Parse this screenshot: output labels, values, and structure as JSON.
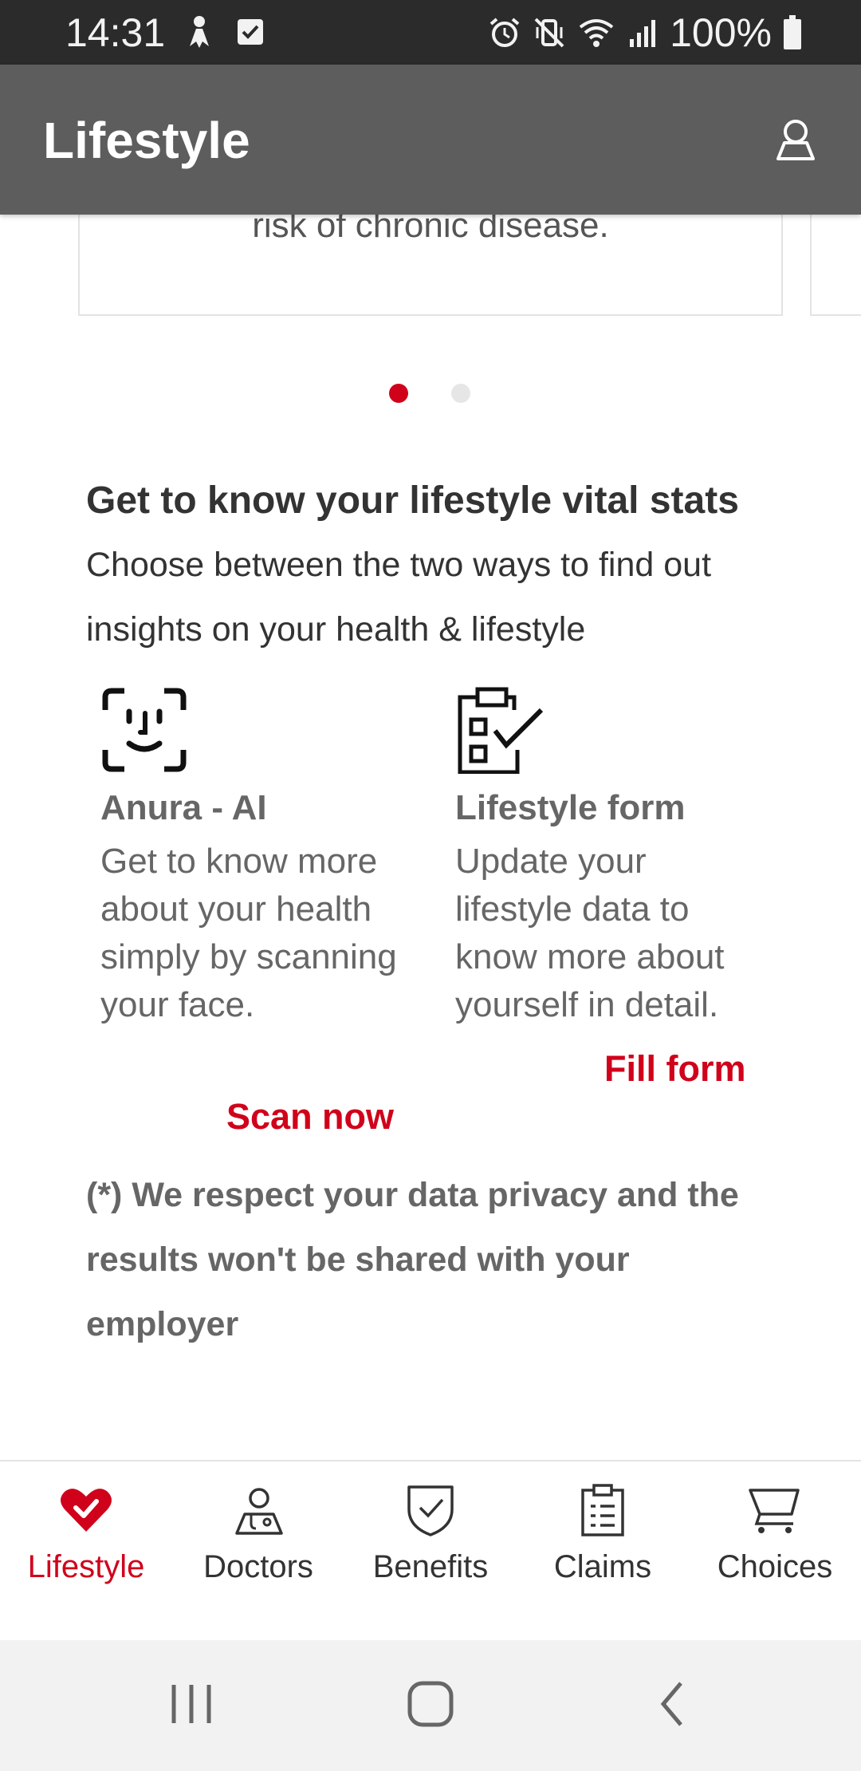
{
  "status_bar": {
    "time": "14:31",
    "battery": "100%",
    "icons": [
      "person-icon",
      "checkbox-icon",
      "alarm-icon",
      "vibrate-icon",
      "wifi-icon",
      "signal-icon",
      "battery-icon"
    ]
  },
  "app_bar": {
    "title": "Lifestyle",
    "profile_icon": "profile-icon"
  },
  "carousel": {
    "card_text": "risk of chronic disease.",
    "page_count": 2,
    "active_index": 0
  },
  "vital_stats": {
    "title": "Get to know your lifestyle vital stats",
    "subtitle": "Choose between the two ways to find out insights on your health & lifestyle",
    "options": [
      {
        "icon": "face-scan-icon",
        "title": "Anura - AI",
        "description": "Get to know more about your health simply by scanning your face.",
        "action": "Scan now"
      },
      {
        "icon": "clipboard-checklist-icon",
        "title": "Lifestyle form",
        "description": "Update your lifestyle data to know more about yourself in detail.",
        "action": "Fill form"
      }
    ],
    "privacy_note": "(*) We respect your data privacy and the results won't be shared with your employer"
  },
  "bottom_nav": {
    "items": [
      {
        "label": "Lifestyle",
        "icon": "heart-check-icon",
        "active": true
      },
      {
        "label": "Doctors",
        "icon": "doctor-icon",
        "active": false
      },
      {
        "label": "Benefits",
        "icon": "shield-check-icon",
        "active": false
      },
      {
        "label": "Claims",
        "icon": "clipboard-icon",
        "active": false
      },
      {
        "label": "Choices",
        "icon": "cart-icon",
        "active": false
      }
    ]
  },
  "colors": {
    "accent": "#d0021b",
    "app_bar": "#5d5d5d",
    "status_bar": "#2b2b2b",
    "text_muted": "#666666"
  }
}
